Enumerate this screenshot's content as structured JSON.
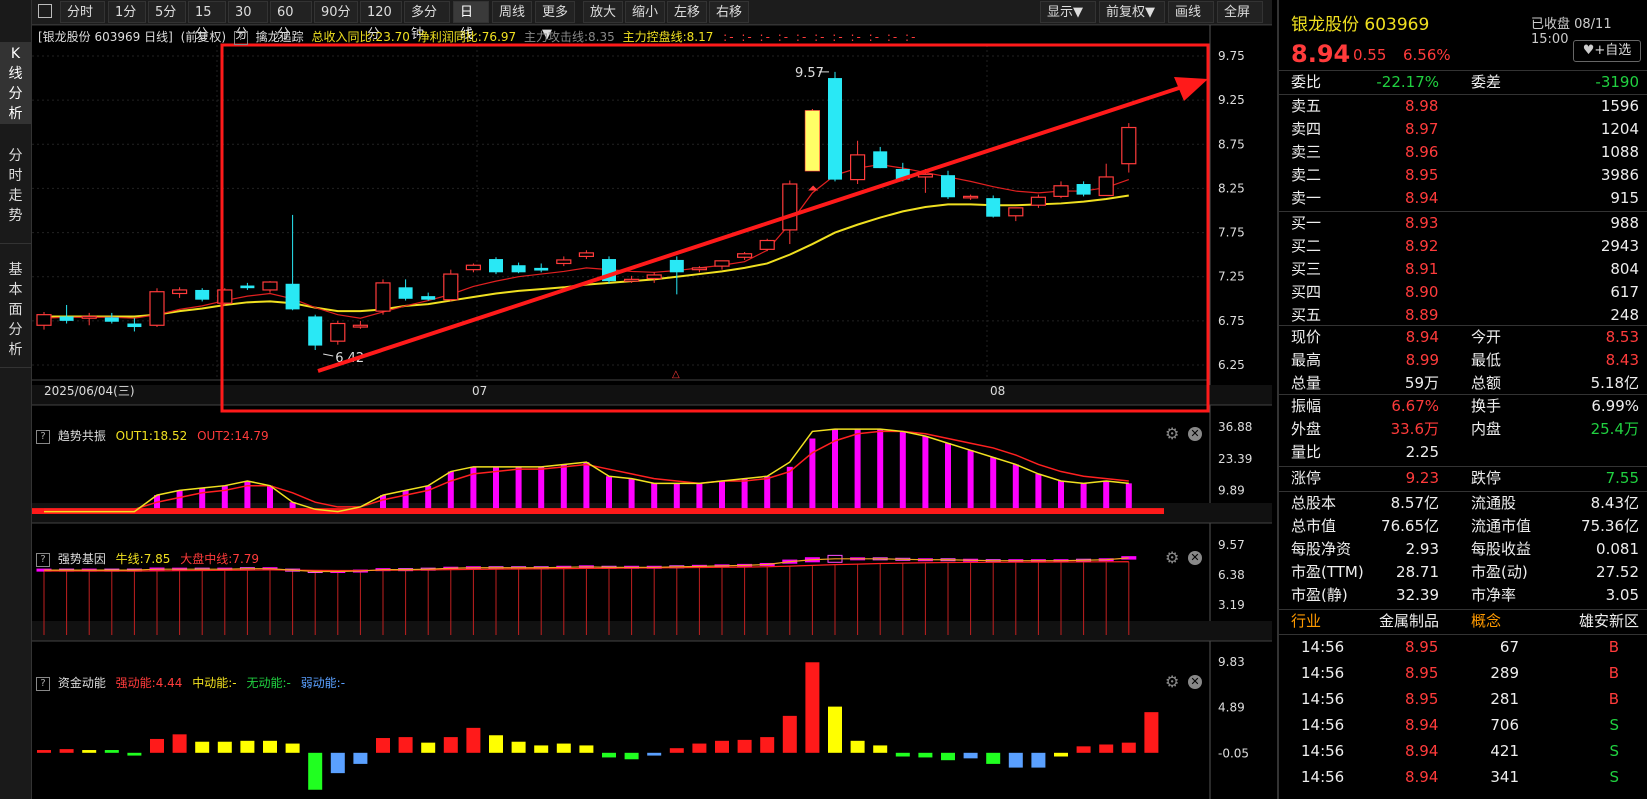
{
  "toolbar": {
    "periods": [
      "分时",
      "1分",
      "5分",
      "15分",
      "30分",
      "60分",
      "90分",
      "120分",
      "多分钟",
      "日线",
      "周线",
      "更多▼"
    ],
    "active": "日线",
    "tools": [
      "放大",
      "缩小",
      "左移",
      "右移"
    ],
    "right_tools": [
      "显示▼",
      "前复权▼",
      "画线",
      "全屏"
    ]
  },
  "sidebar": {
    "tabs": [
      "K线分析",
      "分时走势",
      "基本面分析"
    ]
  },
  "main_chart": {
    "title": "[银龙股份 603969 日线]",
    "adjust": "(前复权)",
    "indicator_name": "擒龙追踪",
    "ind1": "总收入同比:23.70",
    "ind2": "净利润同比:76.97",
    "ind3": "主力攻击线:8.35",
    "ind4": "主力控盘线:8.17",
    "date_label": "2025/06/04(三)",
    "month_labels": [
      "07",
      "08"
    ],
    "y_ticks": [
      "9.75",
      "9.25",
      "8.75",
      "8.25",
      "7.75",
      "7.25",
      "6.75",
      "6.25"
    ],
    "high_label": "9.57",
    "low_label": "6.42"
  },
  "panel2": {
    "name": "趋势共振",
    "l1": "OUT1:18.52",
    "l2": "OUT2:14.79",
    "y_ticks": [
      "36.88",
      "23.39",
      "9.89"
    ]
  },
  "panel3": {
    "name": "强势基因",
    "l1": "牛线:7.85",
    "l2": "大盘中线:7.79",
    "y_ticks": [
      "9.57",
      "6.38",
      "3.19"
    ]
  },
  "panel4": {
    "name": "资金动能",
    "l1": "强动能:4.44",
    "l2": "中动能:-",
    "l3": "无动能:-",
    "l4": "弱动能:-",
    "y_ticks": [
      "9.83",
      "4.89",
      "-0.05"
    ]
  },
  "colors": {
    "up": "#ff3b3b",
    "down": "#29e8f5",
    "ma_yellow": "#f0e020",
    "ma_red": "#e02020",
    "magenta": "#ff00ff"
  },
  "chart_data": {
    "type": "candlestick",
    "candles": [
      {
        "o": 6.7,
        "h": 6.85,
        "l": 6.65,
        "c": 6.82
      },
      {
        "o": 6.8,
        "h": 6.93,
        "l": 6.72,
        "c": 6.75
      },
      {
        "o": 6.78,
        "h": 6.84,
        "l": 6.7,
        "c": 6.8
      },
      {
        "o": 6.79,
        "h": 6.84,
        "l": 6.72,
        "c": 6.74
      },
      {
        "o": 6.72,
        "h": 6.78,
        "l": 6.63,
        "c": 6.68
      },
      {
        "o": 6.7,
        "h": 7.12,
        "l": 6.68,
        "c": 7.08
      },
      {
        "o": 7.06,
        "h": 7.13,
        "l": 7.01,
        "c": 7.1
      },
      {
        "o": 7.1,
        "h": 7.12,
        "l": 6.97,
        "c": 6.99
      },
      {
        "o": 6.95,
        "h": 7.12,
        "l": 6.92,
        "c": 7.1
      },
      {
        "o": 7.15,
        "h": 7.18,
        "l": 7.1,
        "c": 7.12
      },
      {
        "o": 7.1,
        "h": 7.2,
        "l": 7.07,
        "c": 7.19
      },
      {
        "o": 7.17,
        "h": 7.95,
        "l": 6.87,
        "c": 6.88
      },
      {
        "o": 6.8,
        "h": 6.82,
        "l": 6.42,
        "c": 6.47
      },
      {
        "o": 6.52,
        "h": 6.75,
        "l": 6.48,
        "c": 6.72
      },
      {
        "o": 6.68,
        "h": 6.75,
        "l": 6.66,
        "c": 6.7
      },
      {
        "o": 6.86,
        "h": 7.22,
        "l": 6.82,
        "c": 7.18
      },
      {
        "o": 7.13,
        "h": 7.22,
        "l": 6.98,
        "c": 7.0
      },
      {
        "o": 7.03,
        "h": 7.07,
        "l": 6.98,
        "c": 6.99
      },
      {
        "o": 6.99,
        "h": 7.33,
        "l": 6.97,
        "c": 7.28
      },
      {
        "o": 7.33,
        "h": 7.4,
        "l": 7.3,
        "c": 7.38
      },
      {
        "o": 7.45,
        "h": 7.47,
        "l": 7.28,
        "c": 7.3
      },
      {
        "o": 7.38,
        "h": 7.41,
        "l": 7.29,
        "c": 7.3
      },
      {
        "o": 7.35,
        "h": 7.4,
        "l": 7.3,
        "c": 7.32
      },
      {
        "o": 7.4,
        "h": 7.48,
        "l": 7.37,
        "c": 7.44
      },
      {
        "o": 7.48,
        "h": 7.55,
        "l": 7.45,
        "c": 7.52
      },
      {
        "o": 7.45,
        "h": 7.48,
        "l": 7.17,
        "c": 7.2
      },
      {
        "o": 7.2,
        "h": 7.26,
        "l": 7.18,
        "c": 7.22
      },
      {
        "o": 7.23,
        "h": 7.3,
        "l": 7.18,
        "c": 7.27
      },
      {
        "o": 7.44,
        "h": 7.48,
        "l": 7.05,
        "c": 7.3
      },
      {
        "o": 7.33,
        "h": 7.37,
        "l": 7.3,
        "c": 7.35
      },
      {
        "o": 7.37,
        "h": 7.42,
        "l": 7.33,
        "c": 7.43
      },
      {
        "o": 7.47,
        "h": 7.53,
        "l": 7.44,
        "c": 7.51
      },
      {
        "o": 7.56,
        "h": 7.68,
        "l": 7.54,
        "c": 7.66
      },
      {
        "o": 7.78,
        "h": 8.34,
        "l": 7.62,
        "c": 8.3
      },
      {
        "o": 8.45,
        "h": 9.15,
        "l": 8.45,
        "c": 9.13
      },
      {
        "o": 9.5,
        "h": 9.57,
        "l": 8.33,
        "c": 8.35
      },
      {
        "o": 8.35,
        "h": 8.79,
        "l": 8.3,
        "c": 8.63
      },
      {
        "o": 8.67,
        "h": 8.72,
        "l": 8.48,
        "c": 8.48
      },
      {
        "o": 8.47,
        "h": 8.54,
        "l": 8.33,
        "c": 8.35
      },
      {
        "o": 8.38,
        "h": 8.47,
        "l": 8.2,
        "c": 8.41
      },
      {
        "o": 8.4,
        "h": 8.45,
        "l": 8.13,
        "c": 8.15
      },
      {
        "o": 8.16,
        "h": 8.18,
        "l": 8.12,
        "c": 8.16
      },
      {
        "o": 8.14,
        "h": 8.17,
        "l": 7.92,
        "c": 7.93
      },
      {
        "o": 7.94,
        "h": 8.0,
        "l": 7.88,
        "c": 8.03
      },
      {
        "o": 8.06,
        "h": 8.18,
        "l": 8.03,
        "c": 8.15
      },
      {
        "o": 8.16,
        "h": 8.33,
        "l": 8.14,
        "c": 8.28
      },
      {
        "o": 8.3,
        "h": 8.33,
        "l": 8.16,
        "c": 8.18
      },
      {
        "o": 8.17,
        "h": 8.53,
        "l": 8.17,
        "c": 8.38
      },
      {
        "o": 8.53,
        "h": 8.99,
        "l": 8.43,
        "c": 8.94
      }
    ],
    "ma_yellow": [
      6.8,
      6.8,
      6.8,
      6.8,
      6.8,
      6.82,
      6.86,
      6.89,
      6.93,
      6.96,
      6.97,
      6.95,
      6.9,
      6.86,
      6.86,
      6.88,
      6.92,
      6.94,
      6.98,
      7.02,
      7.06,
      7.09,
      7.11,
      7.13,
      7.16,
      7.18,
      7.2,
      7.22,
      7.25,
      7.28,
      7.31,
      7.35,
      7.4,
      7.5,
      7.62,
      7.75,
      7.84,
      7.92,
      7.99,
      8.04,
      8.07,
      8.07,
      8.06,
      8.06,
      8.07,
      8.08,
      8.1,
      8.13,
      8.17
    ],
    "ma_red": [
      6.78,
      6.79,
      6.79,
      6.79,
      6.78,
      6.82,
      6.88,
      6.92,
      6.98,
      7.03,
      7.06,
      7.0,
      6.9,
      6.82,
      6.78,
      6.85,
      6.92,
      6.98,
      7.05,
      7.14,
      7.2,
      7.25,
      7.28,
      7.31,
      7.35,
      7.33,
      7.31,
      7.3,
      7.32,
      7.35,
      7.38,
      7.42,
      7.55,
      7.85,
      8.2,
      8.4,
      8.48,
      8.52,
      8.48,
      8.43,
      8.38,
      8.33,
      8.27,
      8.22,
      8.2,
      8.22,
      8.22,
      8.26,
      8.35
    ],
    "p2_bars": [
      1,
      1,
      1,
      1,
      1,
      8,
      10,
      11,
      12,
      14,
      12,
      5,
      2,
      1,
      3,
      8,
      10,
      12,
      18,
      20,
      20,
      20,
      20,
      21,
      22,
      16,
      15,
      13,
      13,
      13,
      14,
      15,
      16,
      20,
      32,
      36,
      36,
      36,
      35,
      33,
      30,
      27,
      24,
      21,
      17,
      14,
      13,
      14,
      13,
      15,
      20
    ],
    "p2_out1": [
      1,
      1,
      1,
      1,
      1,
      8,
      10,
      11,
      12,
      14,
      12,
      5,
      2,
      1,
      3,
      8,
      10,
      12,
      18,
      20,
      20,
      20,
      20,
      21,
      22,
      16,
      15,
      13,
      13,
      13,
      14,
      15,
      16,
      22,
      35,
      36,
      36,
      36,
      35,
      33,
      30,
      27,
      24,
      21,
      17,
      14,
      13,
      14,
      13,
      15,
      20
    ],
    "p2_out2": [
      2,
      2,
      2,
      2,
      2,
      5,
      7,
      9,
      10,
      12,
      12,
      9,
      5,
      3,
      3,
      6,
      8,
      10,
      14,
      17,
      18,
      19,
      19,
      20,
      21,
      19,
      17,
      15,
      14,
      13,
      14,
      14,
      15,
      18,
      26,
      31,
      34,
      35,
      35,
      34,
      32,
      30,
      28,
      25,
      21,
      18,
      16,
      15,
      14,
      14,
      15
    ],
    "p3_bull": [
      6.9,
      6.9,
      6.9,
      6.9,
      6.9,
      7.0,
      7.0,
      7.0,
      7.0,
      7.05,
      7.05,
      6.9,
      6.75,
      6.75,
      6.8,
      6.95,
      6.95,
      7.0,
      7.1,
      7.15,
      7.15,
      7.15,
      7.15,
      7.2,
      7.25,
      7.2,
      7.2,
      7.2,
      7.25,
      7.3,
      7.35,
      7.4,
      7.5,
      7.8,
      8.0,
      8.1,
      8.1,
      8.1,
      8.05,
      8.0,
      8.0,
      7.95,
      7.9,
      7.9,
      7.9,
      7.9,
      7.95,
      8.0,
      8.2
    ],
    "p3_mid": [
      6.8,
      6.8,
      6.8,
      6.8,
      6.8,
      6.82,
      6.84,
      6.86,
      6.88,
      6.9,
      6.92,
      6.9,
      6.88,
      6.86,
      6.86,
      6.88,
      6.9,
      6.92,
      6.95,
      6.98,
      7.0,
      7.02,
      7.04,
      7.06,
      7.08,
      7.1,
      7.12,
      7.14,
      7.16,
      7.18,
      7.2,
      7.22,
      7.26,
      7.32,
      7.4,
      7.48,
      7.54,
      7.6,
      7.64,
      7.68,
      7.7,
      7.72,
      7.73,
      7.74,
      7.75,
      7.76,
      7.77,
      7.78,
      7.79
    ],
    "p4_bars": [
      0.3,
      0.4,
      0.3,
      0.3,
      -0.3,
      1.5,
      2.0,
      1.2,
      1.2,
      1.3,
      1.3,
      1.0,
      -4.0,
      -2.2,
      -1.2,
      1.6,
      1.7,
      1.1,
      1.7,
      2.7,
      1.9,
      1.2,
      0.8,
      1.0,
      0.8,
      -0.5,
      -0.7,
      -0.3,
      0.5,
      1.0,
      1.3,
      1.4,
      1.7,
      4.0,
      9.8,
      5.0,
      1.3,
      0.8,
      -0.4,
      -0.5,
      -0.8,
      -0.6,
      -1.2,
      -1.6,
      -1.6,
      -0.4,
      0.7,
      0.9,
      1.1,
      4.4
    ],
    "p4_colors": [
      "r",
      "r",
      "y",
      "g",
      "g",
      "r",
      "r",
      "y",
      "y",
      "y",
      "y",
      "y",
      "g",
      "b",
      "b",
      "r",
      "r",
      "y",
      "r",
      "r",
      "y",
      "y",
      "y",
      "y",
      "y",
      "g",
      "g",
      "b",
      "r",
      "r",
      "r",
      "r",
      "r",
      "r",
      "r",
      "y",
      "y",
      "y",
      "g",
      "g",
      "g",
      "b",
      "g",
      "b",
      "b",
      "y",
      "r",
      "r",
      "r",
      "r"
    ]
  },
  "quote": {
    "name": "银龙股份 603969",
    "status": "已收盘 08/11 15:00",
    "price": "8.94",
    "change": "0.55",
    "pct": "6.56%",
    "add_btn": "+自选",
    "weibi_label": "委比",
    "weibi": "-22.17%",
    "weicha_label": "委差",
    "weicha": "-3190",
    "asks": [
      {
        "l": "卖五",
        "p": "8.98",
        "v": "1596"
      },
      {
        "l": "卖四",
        "p": "8.97",
        "v": "1204"
      },
      {
        "l": "卖三",
        "p": "8.96",
        "v": "1088"
      },
      {
        "l": "卖二",
        "p": "8.95",
        "v": "3986"
      },
      {
        "l": "卖一",
        "p": "8.94",
        "v": "915"
      }
    ],
    "bids": [
      {
        "l": "买一",
        "p": "8.93",
        "v": "988"
      },
      {
        "l": "买二",
        "p": "8.92",
        "v": "2943"
      },
      {
        "l": "买三",
        "p": "8.91",
        "v": "804"
      },
      {
        "l": "买四",
        "p": "8.90",
        "v": "617"
      },
      {
        "l": "买五",
        "p": "8.89",
        "v": "248"
      }
    ],
    "stats1": [
      {
        "l1": "现价",
        "v1": "8.94",
        "c1": "red",
        "l2": "今开",
        "v2": "8.53",
        "c2": "red"
      },
      {
        "l1": "最高",
        "v1": "8.99",
        "c1": "red",
        "l2": "最低",
        "v2": "8.43",
        "c2": "red"
      },
      {
        "l1": "总量",
        "v1": "59万",
        "c1": "white",
        "l2": "总额",
        "v2": "5.18亿",
        "c2": "white"
      }
    ],
    "stats2": [
      {
        "l1": "振幅",
        "v1": "6.67%",
        "c1": "red",
        "l2": "换手",
        "v2": "6.99%",
        "c2": "white"
      },
      {
        "l1": "外盘",
        "v1": "33.6万",
        "c1": "red",
        "l2": "内盘",
        "v2": "25.4万",
        "c2": "green"
      },
      {
        "l1": "量比",
        "v1": "2.25",
        "c1": "white",
        "l2": "",
        "v2": "",
        "c2": "white"
      }
    ],
    "limits": {
      "l1": "涨停",
      "v1": "9.23",
      "l2": "跌停",
      "v2": "7.55"
    },
    "stats3": [
      {
        "l1": "总股本",
        "v1": "8.57亿",
        "l2": "流通股",
        "v2": "8.43亿"
      },
      {
        "l1": "总市值",
        "v1": "76.65亿",
        "l2": "流通市值",
        "v2": "75.36亿"
      },
      {
        "l1": "每股净资",
        "v1": "2.93",
        "l2": "每股收益",
        "v2": "0.081"
      },
      {
        "l1": "市盈(TTM)",
        "v1": "28.71",
        "l2": "市盈(动)",
        "v2": "27.52"
      },
      {
        "l1": "市盈(静)",
        "v1": "32.39",
        "l2": "市净率",
        "v2": "3.05"
      }
    ],
    "industry": {
      "l1": "行业",
      "v1": "金属制品",
      "l2": "概念",
      "v2": "雄安新区"
    },
    "ticks": [
      {
        "t": "14:56",
        "p": "8.95",
        "v": "67",
        "s": "B"
      },
      {
        "t": "14:56",
        "p": "8.95",
        "v": "289",
        "s": "B"
      },
      {
        "t": "14:56",
        "p": "8.95",
        "v": "281",
        "s": "B"
      },
      {
        "t": "14:56",
        "p": "8.94",
        "v": "706",
        "s": "S"
      },
      {
        "t": "14:56",
        "p": "8.94",
        "v": "421",
        "s": "S"
      },
      {
        "t": "14:56",
        "p": "8.94",
        "v": "341",
        "s": "S"
      }
    ]
  }
}
